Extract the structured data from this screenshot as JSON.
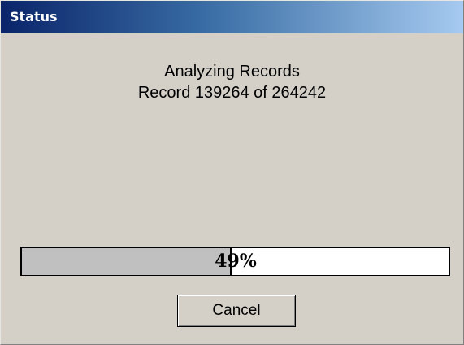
{
  "window": {
    "title": "Status"
  },
  "status": {
    "line1": "Analyzing Records",
    "line2": "Record 139264 of 264242"
  },
  "progress": {
    "percent": 49,
    "label": "49%"
  },
  "buttons": {
    "cancel_label": "Cancel"
  },
  "colors": {
    "title_gradient_start": "#0a246a",
    "title_gradient_end": "#a6caf0",
    "dialog_background": "#d4d0c8",
    "progress_fill": "#c0c0c0"
  }
}
